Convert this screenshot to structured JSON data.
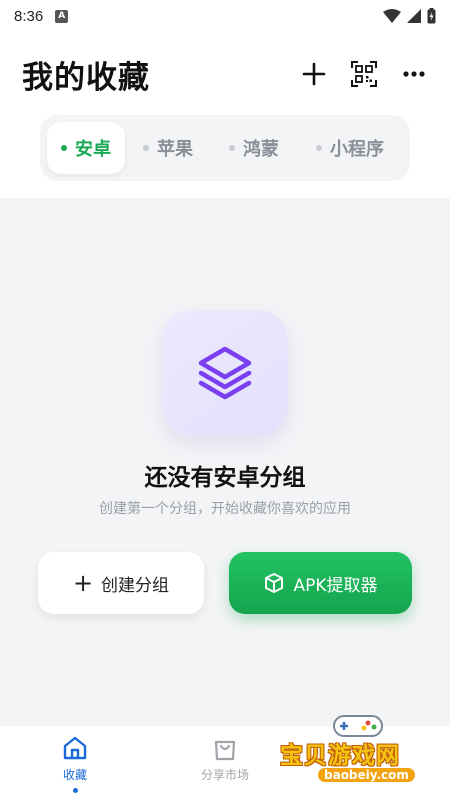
{
  "status_bar": {
    "time": "8:36",
    "app_badge": "A"
  },
  "header": {
    "title": "我的收藏"
  },
  "tabs": [
    {
      "label": "安卓",
      "active": true
    },
    {
      "label": "苹果",
      "active": false
    },
    {
      "label": "鸿蒙",
      "active": false
    },
    {
      "label": "小程序",
      "active": false
    }
  ],
  "empty_state": {
    "title": "还没有安卓分组",
    "subtitle": "创建第一个分组，开始收藏你喜欢的应用"
  },
  "actions": {
    "create_label": "创建分组",
    "apk_label": "APK提取器"
  },
  "bottom_nav": [
    {
      "label": "收藏",
      "active": true
    },
    {
      "label": "分享市场",
      "active": false
    }
  ],
  "watermark": {
    "text": "宝贝游戏网",
    "url": "baobeiy.com"
  },
  "colors": {
    "accent_green": "#1aa954",
    "nav_active": "#1a6ad9",
    "icon_purple": "#7a3ff0"
  }
}
